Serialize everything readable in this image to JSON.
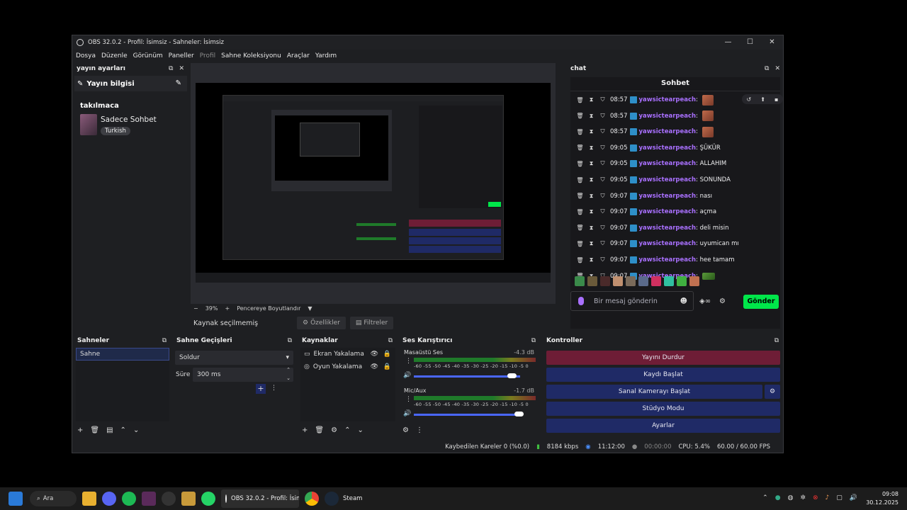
{
  "window": {
    "title": "OBS 32.0.2 - Profil: İsimsiz - Sahneler: İsimsiz",
    "min": "—",
    "max": "☐",
    "close": "✕"
  },
  "menu": [
    "Dosya",
    "Düzenle",
    "Görünüm",
    "Paneller",
    "Profil",
    "Sahne Koleksiyonu",
    "Araçlar",
    "Yardım"
  ],
  "left_dock": {
    "title": "yayın ayarları",
    "stream_info": "Yayın bilgisi",
    "category_title": "takılmaca",
    "category_name": "Sadece Sohbet",
    "language": "Turkish"
  },
  "preview": {
    "zoom": "39%",
    "zoom_minus": "−",
    "zoom_plus": "+",
    "fit_label": "Pencereye Boyutlandır",
    "no_source": "Kaynak seçilmemiş",
    "properties": "Özellikler",
    "filters": "Filtreler"
  },
  "chat": {
    "dock_title": "chat",
    "header": "Sohbet",
    "messages": [
      {
        "time": "08:57",
        "user": "yawsictearpeach",
        "text": "",
        "emote": true
      },
      {
        "time": "08:57",
        "user": "yawsictearpeach",
        "text": "",
        "emote": true
      },
      {
        "time": "08:57",
        "user": "yawsictearpeach",
        "text": "",
        "emote": true
      },
      {
        "time": "09:05",
        "user": "yawsictearpeach",
        "text": "ŞÜKÜR"
      },
      {
        "time": "09:05",
        "user": "yawsictearpeach",
        "text": "ALLAHIM"
      },
      {
        "time": "09:05",
        "user": "yawsictearpeach",
        "text": "SONUNDA"
      },
      {
        "time": "09:07",
        "user": "yawsictearpeach",
        "text": "nası"
      },
      {
        "time": "09:07",
        "user": "yawsictearpeach",
        "text": "açma"
      },
      {
        "time": "09:07",
        "user": "yawsictearpeach",
        "text": "deli misin"
      },
      {
        "time": "09:07",
        "user": "yawsictearpeach",
        "text": "uyumican mı"
      },
      {
        "time": "09:07",
        "user": "yawsictearpeach",
        "text": "hee tamam"
      },
      {
        "time": "09:07",
        "user": "yawsictearpeach",
        "text": "",
        "frog": true
      }
    ],
    "input_placeholder": "Bir mesaj gönderin",
    "send": "Gönder"
  },
  "scenes": {
    "title": "Sahneler",
    "items": [
      "Sahne"
    ]
  },
  "transitions": {
    "title": "Sahne Geçişleri",
    "type": "Soldur",
    "duration_label": "Süre",
    "duration": "300 ms"
  },
  "sources": {
    "title": "Kaynaklar",
    "items": [
      "Ekran Yakalama",
      "Oyun Yakalama"
    ]
  },
  "mixer": {
    "title": "Ses Karıştırıcı",
    "tracks": [
      {
        "name": "Masaüstü Ses",
        "db": "-4.3 dB",
        "level": 0.88
      },
      {
        "name": "Mic/Aux",
        "db": "-1.7 dB",
        "level": 0.9
      }
    ],
    "scale": "-60  -55  -50  -45  -40  -35  -30  -25  -20  -15  -10   -5    0"
  },
  "controls": {
    "title": "Kontroller",
    "stop_stream": "Yayını Durdur",
    "start_record": "Kaydı Başlat",
    "virtual_cam": "Sanal Kamerayı Başlat",
    "studio": "Stüdyo Modu",
    "settings": "Ayarlar"
  },
  "status": {
    "dropped": "Kaybedilen Kareler 0 (%0.0)",
    "bitrate": "8184 kbps",
    "stream_time": "11:12:00",
    "rec_time": "00:00:00",
    "cpu": "CPU: 5.4%",
    "fps": "60.00 / 60.00 FPS"
  },
  "taskbar": {
    "search": "Ara",
    "obs_task": "OBS 32.0.2 - Profil: İsimsiz",
    "steam": "Steam",
    "time": "09:08",
    "date": "30.12.2025"
  },
  "colors": {
    "accent_green": "#00e64a",
    "stop_red": "#6e1d36",
    "ctl_blue": "#1f2a66",
    "twitch_purple": "#a970ff"
  }
}
